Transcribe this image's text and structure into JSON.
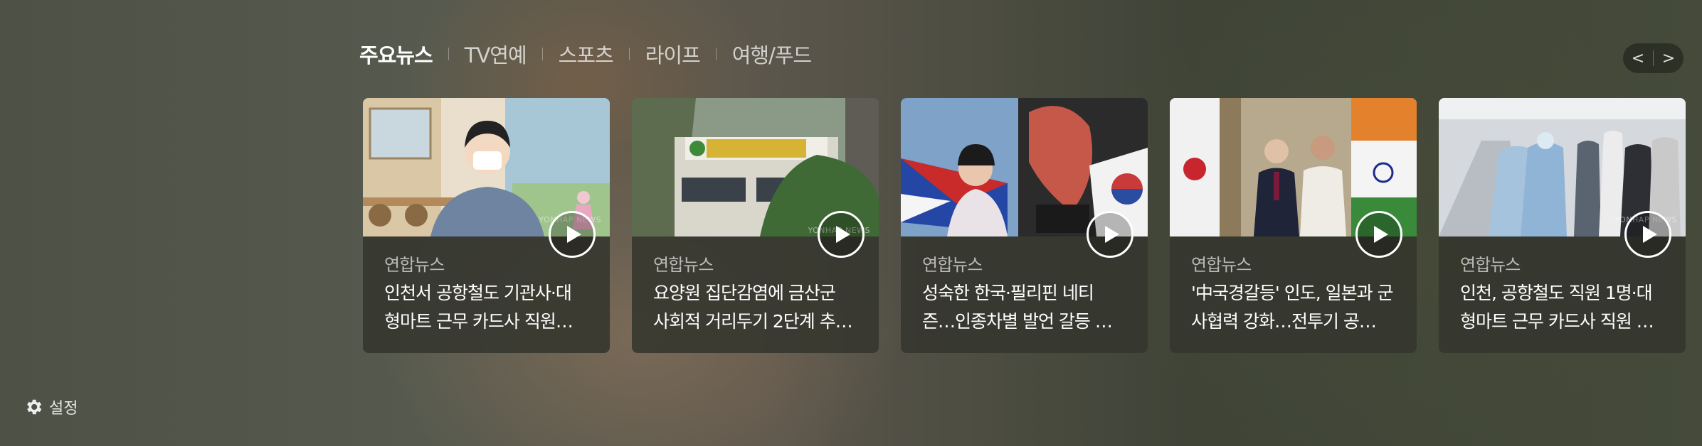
{
  "tabs": [
    {
      "label": "주요뉴스",
      "active": true
    },
    {
      "label": "TV연예",
      "active": false
    },
    {
      "label": "스포츠",
      "active": false
    },
    {
      "label": "라이프",
      "active": false
    },
    {
      "label": "여행/푸드",
      "active": false
    }
  ],
  "nav": {
    "prev_label": "<",
    "next_label": ">"
  },
  "cards": [
    {
      "source": "연합뉴스",
      "title_line1": "인천서 공항철도 기관사·대",
      "title_line2": "형마트 근무 카드사 직원…",
      "watermark": "YONHAP NEWS"
    },
    {
      "source": "연합뉴스",
      "title_line1": "요양원 집단감염에 금산군",
      "title_line2": "사회적 거리두기 2단계 추…",
      "watermark": "YONHAP NEWS"
    },
    {
      "source": "연합뉴스",
      "title_line1": "성숙한 한국·필리핀 네티",
      "title_line2": "즌…인종차별 발언 갈등 …",
      "watermark": ""
    },
    {
      "source": "연합뉴스",
      "title_line1": "'中국경갈등' 인도, 일본과 군",
      "title_line2": "사협력 강화…전투기 공…",
      "watermark": ""
    },
    {
      "source": "연합뉴스",
      "title_line1": "인천, 공항철도 직원 1명·대",
      "title_line2": "형마트 근무 카드사 직원 …",
      "watermark": "YONHAP NEWS"
    }
  ],
  "settings": {
    "label": "설정"
  },
  "icons": {
    "settings": "gear-icon",
    "play": "play-icon",
    "prev": "chevron-left-icon",
    "next": "chevron-right-icon"
  }
}
